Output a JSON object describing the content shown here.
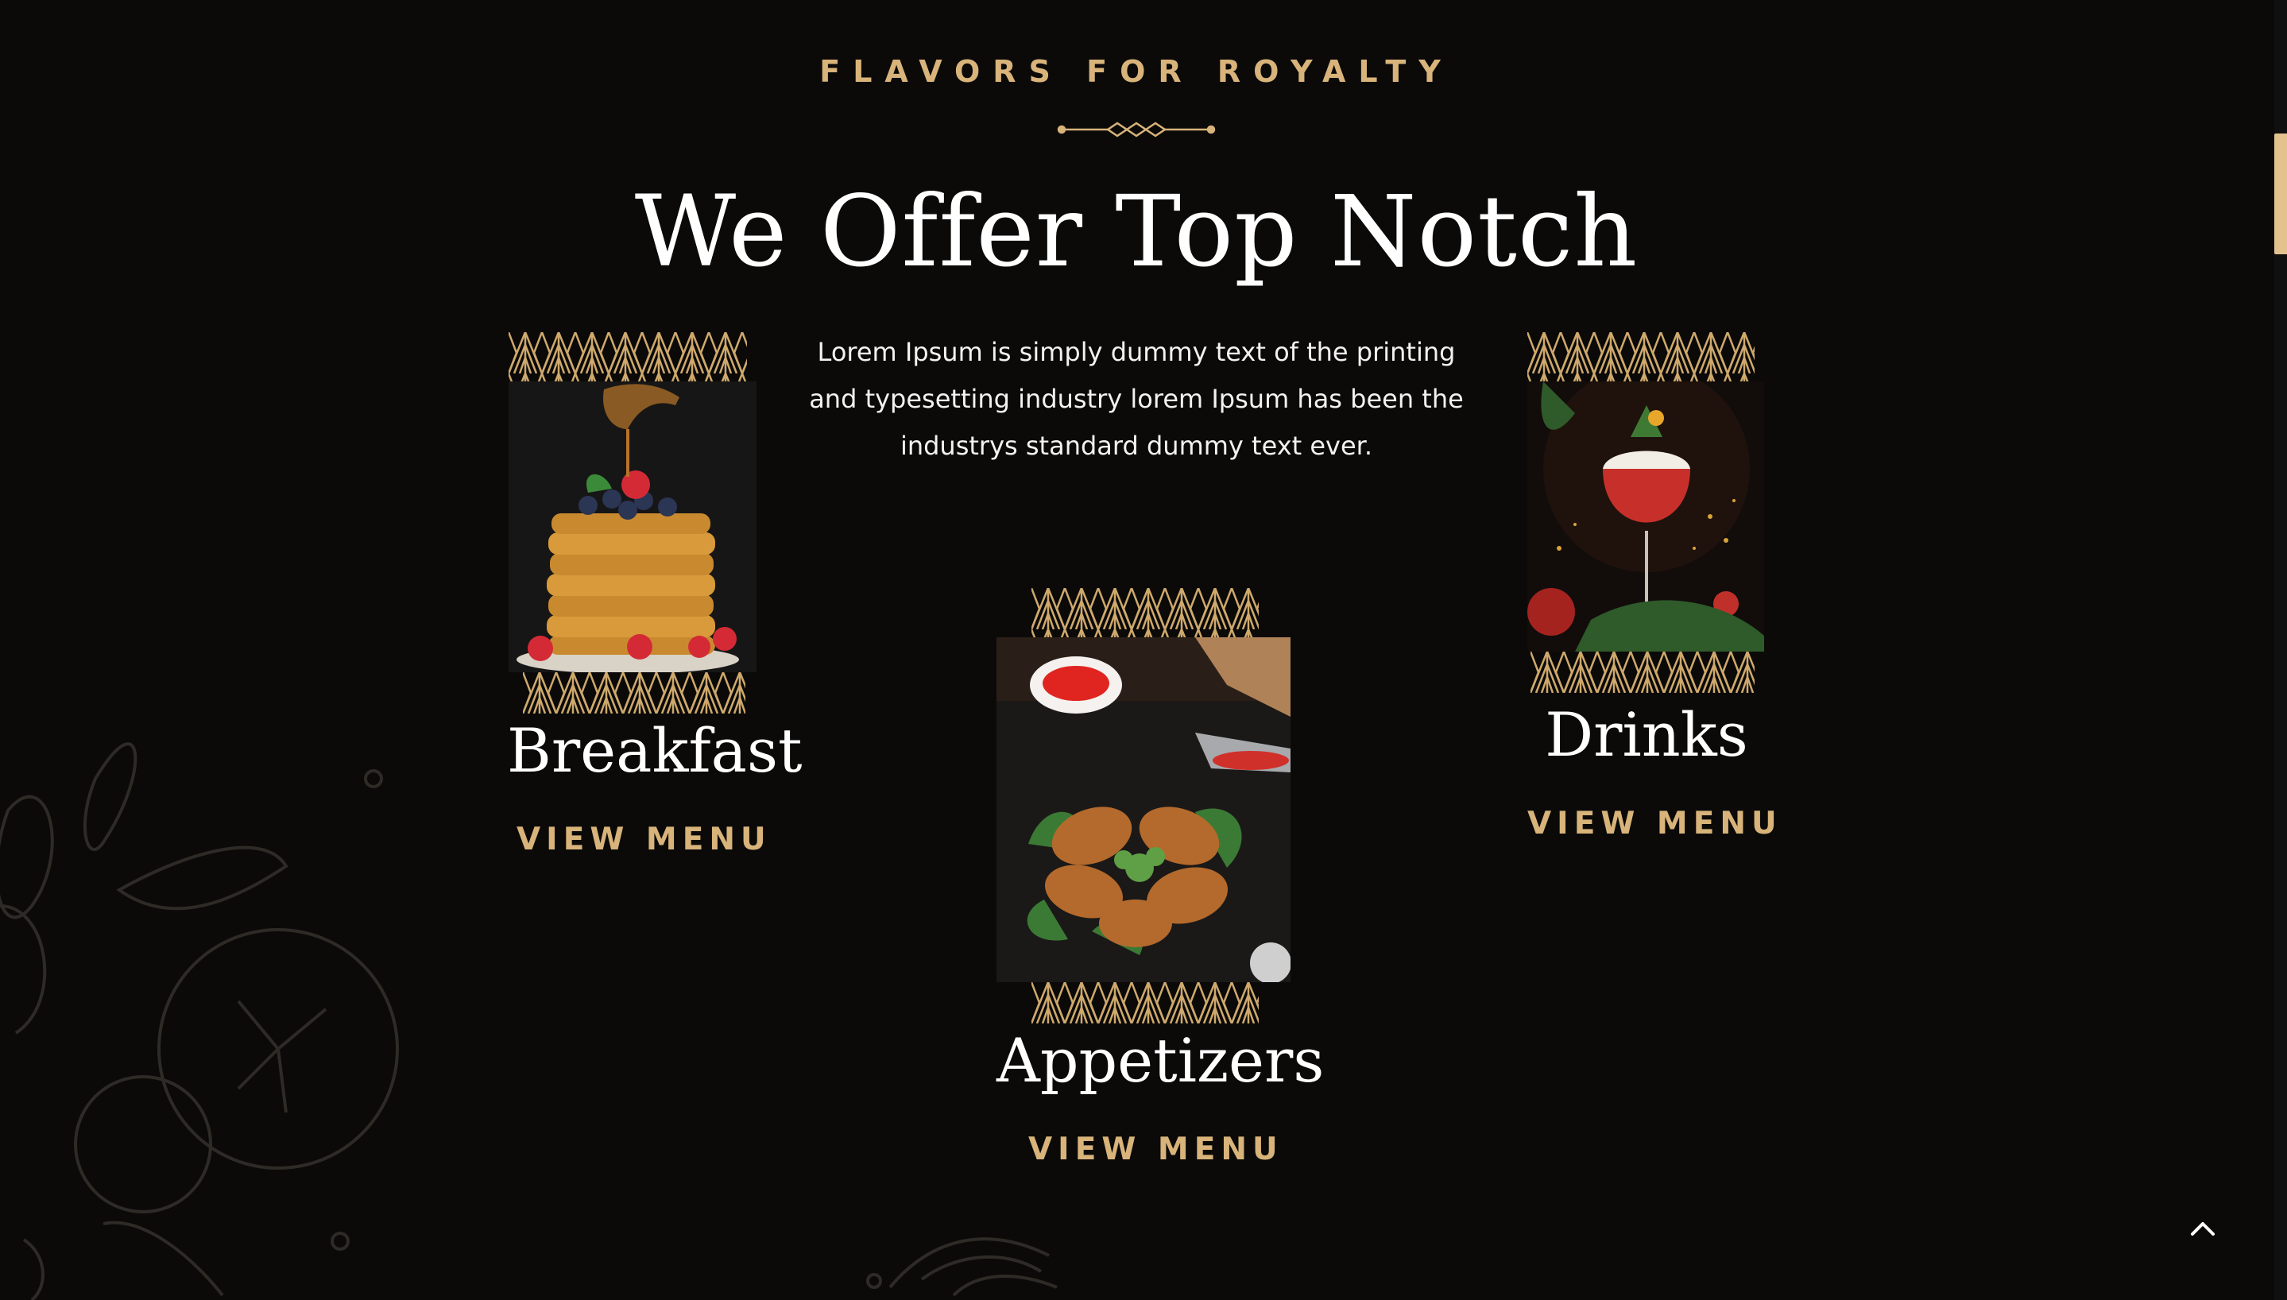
{
  "section": {
    "eyebrow": "FLAVORS FOR ROYALTY",
    "headline": "We Offer Top Notch",
    "intro": "Lorem Ipsum is simply dummy text of the printing and typesetting industry lorem Ipsum has been the industrys standard dummy text ever."
  },
  "cards": [
    {
      "title": "Breakfast",
      "link": "VIEW MENU",
      "image_subject": "stacked pancakes with berries and honey dipper"
    },
    {
      "title": "Appetizers",
      "link": "VIEW MENU",
      "image_subject": "grilled chicken wings with dipping sauces"
    },
    {
      "title": "Drinks",
      "link": "VIEW MENU",
      "image_subject": "red cocktail with foam and garnish"
    }
  ],
  "colors": {
    "background": "#0b0a09",
    "accent_gold": "#d8b37a",
    "headline_white": "#ffffff",
    "scroll_thumb": "#e3c28d"
  },
  "icons": {
    "divider": "ornament-divider-icon",
    "back_to_top": "chevron-up-icon"
  }
}
